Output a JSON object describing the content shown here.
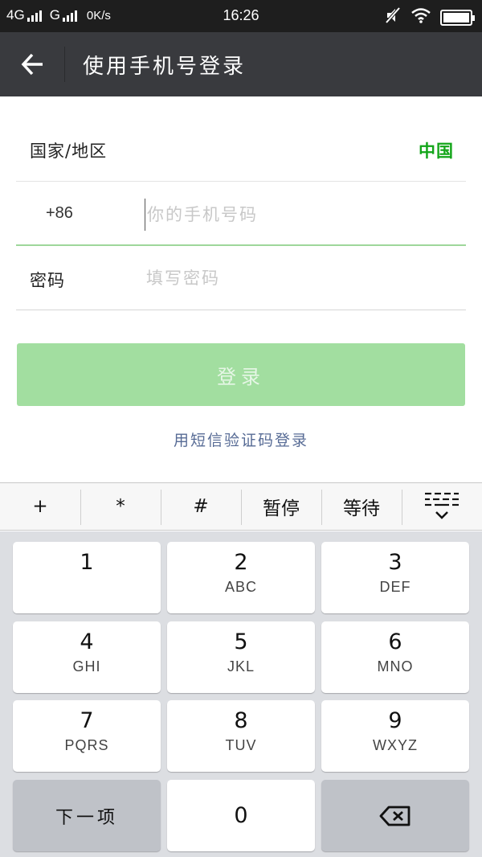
{
  "status_bar": {
    "network1": "4G",
    "network2": "G",
    "speed": "0K/s",
    "time": "16:26"
  },
  "title_bar": {
    "title": "使用手机号登录",
    "back_icon": "arrow-left-icon"
  },
  "form": {
    "region_label": "国家/地区",
    "region_value": "中国",
    "country_code": "+86",
    "phone_placeholder": "你的手机号码",
    "password_label": "密码",
    "password_placeholder": "填写密码",
    "login_button": "登录",
    "sms_login_link": "用短信验证码登录"
  },
  "colors": {
    "title_bar": "#393a3e",
    "status_bar": "#1e1e1e",
    "accent_green": "#12a518",
    "login_button": "#a2dea0",
    "link": "#576b95"
  },
  "keyboard": {
    "toolbar": [
      "+",
      "*",
      "#",
      "暂停",
      "等待"
    ],
    "toolbar_collapse_icon": "keyboard-collapse-icon",
    "keys": [
      {
        "digit": "1",
        "letters": ""
      },
      {
        "digit": "2",
        "letters": "ABC"
      },
      {
        "digit": "3",
        "letters": "DEF"
      },
      {
        "digit": "4",
        "letters": "GHI"
      },
      {
        "digit": "5",
        "letters": "JKL"
      },
      {
        "digit": "6",
        "letters": "MNO"
      },
      {
        "digit": "7",
        "letters": "PQRS"
      },
      {
        "digit": "8",
        "letters": "TUV"
      },
      {
        "digit": "9",
        "letters": "WXYZ"
      }
    ],
    "next_key": "下一项",
    "zero_key": "0",
    "backspace_icon": "backspace-icon"
  }
}
